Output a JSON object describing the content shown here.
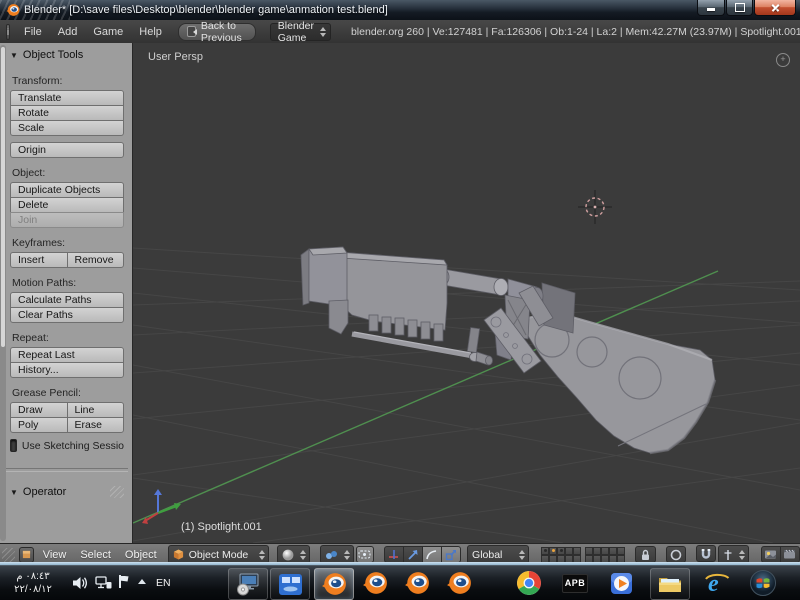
{
  "window": {
    "title": "Blender* [D:\\save files\\Desktop\\blender\\blender game\\anmation test.blend]"
  },
  "info_header": {
    "menus": {
      "file": "File",
      "add": "Add",
      "game": "Game",
      "help": "Help"
    },
    "back_button": "Back to Previous",
    "engine": "Blender Game",
    "stats": "blender.org 260 | Ve:127481 | Fa:126306 | Ob:1-24 | La:2 | Mem:42.27M (23.97M) | Spotlight.001"
  },
  "tool_shelf": {
    "title": "Object Tools",
    "transform_label": "Transform:",
    "translate": "Translate",
    "rotate": "Rotate",
    "scale": "Scale",
    "origin": "Origin",
    "object_label": "Object:",
    "duplicate": "Duplicate Objects",
    "delete_btn": "Delete",
    "join": "Join",
    "keyframes_label": "Keyframes:",
    "insert": "Insert",
    "remove": "Remove",
    "motion_label": "Motion Paths:",
    "calculate_paths": "Calculate Paths",
    "clear_paths": "Clear Paths",
    "repeat_label": "Repeat:",
    "repeat_last": "Repeat Last",
    "history": "History...",
    "grease_label": "Grease Pencil:",
    "draw": "Draw",
    "line": "Line",
    "poly": "Poly",
    "erase": "Erase",
    "sketch_sessions": "Use Sketching Sessio",
    "operator_title": "Operator"
  },
  "viewport": {
    "view_label": "User Persp",
    "selected_object": "(1) Spotlight.001"
  },
  "view_header": {
    "menus": {
      "view": "View",
      "select": "Select",
      "object": "Object"
    },
    "mode": "Object Mode",
    "orientation": "Global"
  },
  "taskbar": {
    "time": "٠٨:٤٣ م",
    "date": "٢٢/٠٨/١٢",
    "language": "EN",
    "apb_label": "APB",
    "ie_glyph": "e",
    "apps": [
      "system-setup",
      "display-settings",
      "blender-active",
      "blender",
      "blender",
      "blender",
      "chrome",
      "apb",
      "media-player",
      "windows-explorer",
      "internet-explorer",
      "start-menu"
    ]
  },
  "colors": {
    "blender_orange": "#ef7e1f",
    "selection_pink": "#d8a8a8",
    "axis_green": "#4f8f4f",
    "viewport_bg": "#3b3b3b",
    "active_layer_dot": "#e8a33d"
  }
}
